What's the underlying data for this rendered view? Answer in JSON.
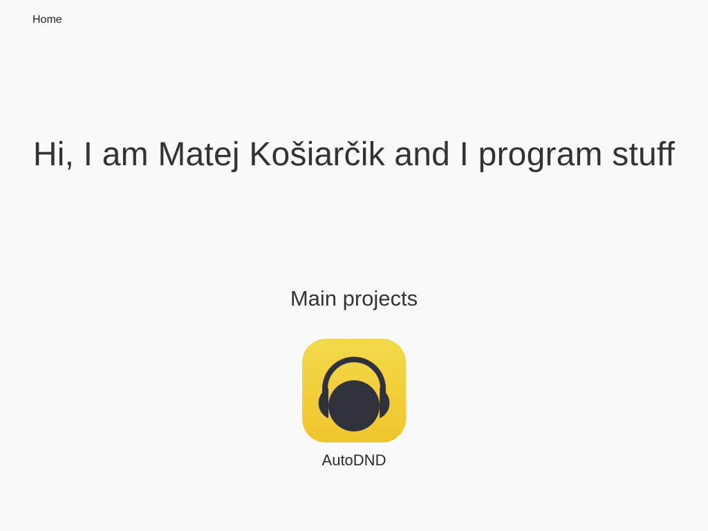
{
  "nav": {
    "home_label": "Home"
  },
  "hero": {
    "title": "Hi, I am Matej Košiarčik and I program stuff"
  },
  "projects_section": {
    "title": "Main projects",
    "items": [
      {
        "name": "AutoDND",
        "icon": "headphones-icon",
        "icon_bg_color": "#f2cf36",
        "icon_fg_color": "#2f323a"
      }
    ]
  },
  "colors": {
    "background": "#f9f9f9",
    "text": "#333333"
  }
}
